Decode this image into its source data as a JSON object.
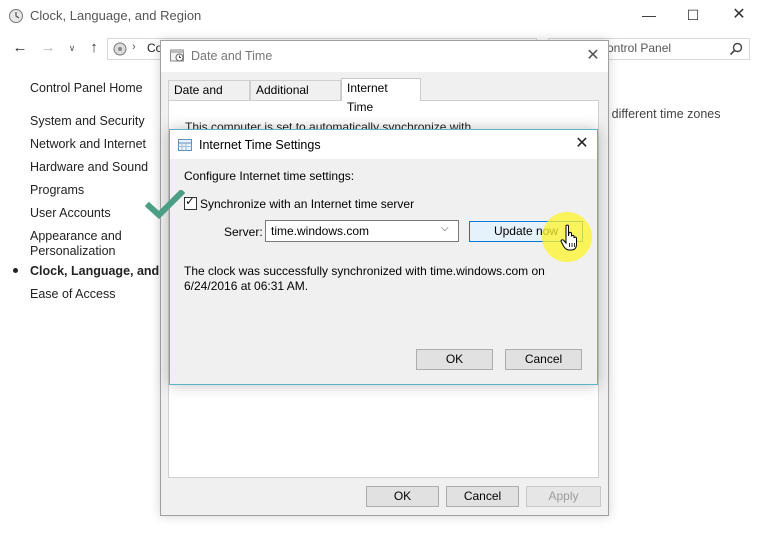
{
  "control_panel": {
    "title": "Clock, Language, and Region",
    "address_text": "Co",
    "search_placeholder": "ontrol Panel",
    "home_link": "Control Panel Home",
    "nav_items": [
      "System and Security",
      "Network and Internet",
      "Hardware and Sound",
      "Programs",
      "User Accounts",
      "Appearance and Personalization",
      "Clock, Language, and Region",
      "Ease of Access"
    ],
    "right_text": "r different time zones"
  },
  "date_time_dialog": {
    "title": "Date and Time",
    "tabs": [
      "Date and Time",
      "Additional Clocks",
      "Internet Time"
    ],
    "panel_text": "This computer is set to automatically synchronize with",
    "ok_label": "OK",
    "cancel_label": "Cancel",
    "apply_label": "Apply"
  },
  "internet_time_dialog": {
    "title": "Internet Time Settings",
    "configure_label": "Configure Internet time settings:",
    "sync_checkbox_label": "Synchronize with an Internet time server",
    "sync_checked": true,
    "server_label": "Server:",
    "server_value": "time.windows.com",
    "update_label": "Update now",
    "status_text": "The clock was successfully synchronized with time.windows.com on 6/24/2016 at 06:31 AM.",
    "ok_label": "OK",
    "cancel_label": "Cancel"
  },
  "colors": {
    "accent_blue": "#0078d7",
    "dialog_border": "#5fb3c9",
    "check_green": "#4a9e84",
    "cursor_highlight": "#fff428"
  },
  "icons": {
    "title_icon": "clock-region-icon",
    "search": "search-icon",
    "close": "close-icon",
    "check": "green-checkmark-icon",
    "cursor": "hand-pointer-icon"
  }
}
